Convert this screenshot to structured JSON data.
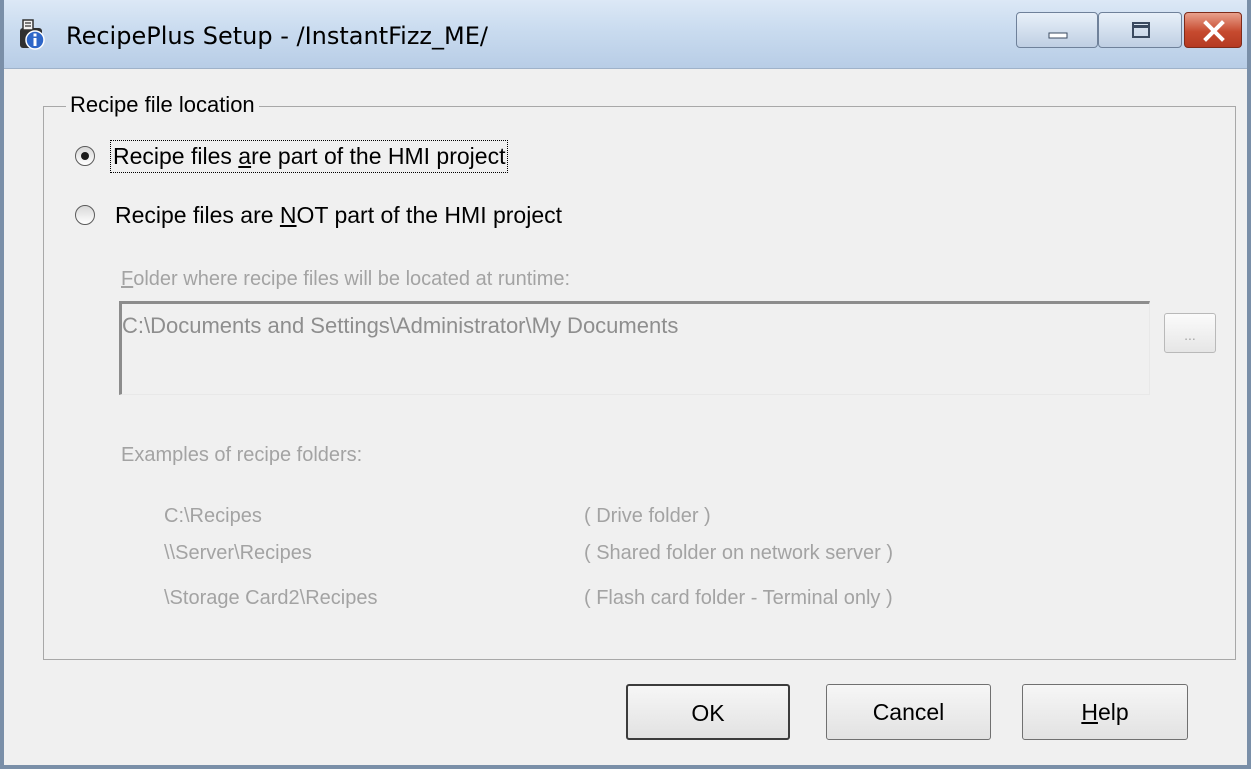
{
  "window": {
    "title": "RecipePlus Setup - /InstantFizz_ME/",
    "controls": {
      "minimize_icon": "minimize-icon",
      "maximize_icon": "maximize-icon",
      "close_icon": "close-icon"
    }
  },
  "group": {
    "label": "Recipe file location",
    "options": [
      {
        "label_pre": "Recipe files ",
        "label_accel": "a",
        "label_post": "re part of the HMI project",
        "selected": true
      },
      {
        "label_pre": "Recipe files are ",
        "label_accel": "N",
        "label_post": "OT part of the HMI project",
        "selected": false
      }
    ],
    "folder": {
      "caption_accel": "F",
      "caption_rest": "older where recipe files will be located at runtime:",
      "value": "C:\\Documents and Settings\\Administrator\\My Documents",
      "browse_label": "..."
    },
    "examples": {
      "caption": "Examples of recipe folders:",
      "rows": [
        {
          "path": "C:\\Recipes",
          "description": "( Drive folder )"
        },
        {
          "path": "\\\\Server\\Recipes",
          "description": "( Shared folder on network server )"
        },
        {
          "path": "\\Storage Card2\\Recipes",
          "description": "( Flash card folder - Terminal only )"
        }
      ]
    }
  },
  "buttons": {
    "ok": "OK",
    "cancel": "Cancel",
    "help_accel": "H",
    "help_rest": "elp"
  },
  "colors": {
    "titlebar": "#c9dbef",
    "close_button": "#c64a2f",
    "dialog_background": "#f0f0f0",
    "disabled_text": "#a3a3a3"
  }
}
